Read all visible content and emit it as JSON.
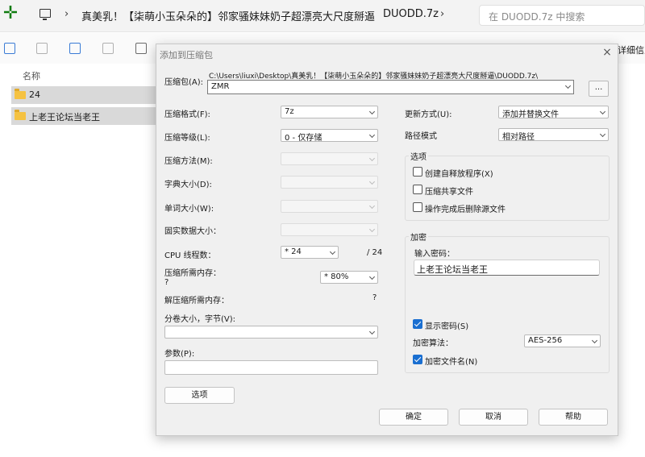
{
  "explorer": {
    "breadcrumbs": [
      "真美乳！【柒萌小玉朵朵的】邻家骚妹妹奶子超漂亮大尺度掰逼",
      "DUODD.7z"
    ],
    "search_placeholder": "在 DUODD.7z 中搜索",
    "detail_label": "详细信息",
    "column_name": "名称",
    "files": [
      "24",
      "上老王论坛当老王"
    ]
  },
  "dialog": {
    "title": "添加到压缩包",
    "close": "×",
    "archive_label": "压缩包(A):",
    "archive_path": "C:\\Users\\liuxi\\Desktop\\真美乳！【柒萌小玉朵朵的】邻家骚妹妹奶子超漂亮大尺度掰逼\\DUODD.7z\\",
    "archive_name": "ZMR",
    "browse_label": "...",
    "format_label": "压缩格式(F):",
    "format_value": "7z",
    "level_label": "压缩等级(L):",
    "level_value": "0 - 仅存储",
    "method_label": "压缩方法(M):",
    "dict_label": "字典大小(D):",
    "word_label": "单词大小(W):",
    "solid_label": "固实数据大小：",
    "cpu_label": "CPU 线程数：",
    "cpu_value": "* 24",
    "cpu_max": "/ 24",
    "mem_label": "压缩所需内存：",
    "mem_hint": "?",
    "mem_value": "* 80%",
    "decomp_label": "解压缩所需内存：",
    "decomp_value": "?",
    "volume_label": "分卷大小，字节(V):",
    "params_label": "参数(P):",
    "options_button": "选项",
    "update_label": "更新方式(U):",
    "update_value": "添加并替换文件",
    "pathmode_label": "路径模式",
    "pathmode_value": "相对路径",
    "options_group": "选项",
    "opt_sfx": "创建自释放程序(X)",
    "opt_shared": "压缩共享文件",
    "opt_delete": "操作完成后删除源文件",
    "encrypt_group": "加密",
    "password_label": "输入密码：",
    "password_value": "上老王论坛当老王",
    "show_password": "显示密码(S)",
    "enc_method_label": "加密算法：",
    "enc_method_value": "AES-256",
    "enc_names": "加密文件名(N)",
    "ok": "确定",
    "cancel": "取消",
    "help": "帮助"
  }
}
